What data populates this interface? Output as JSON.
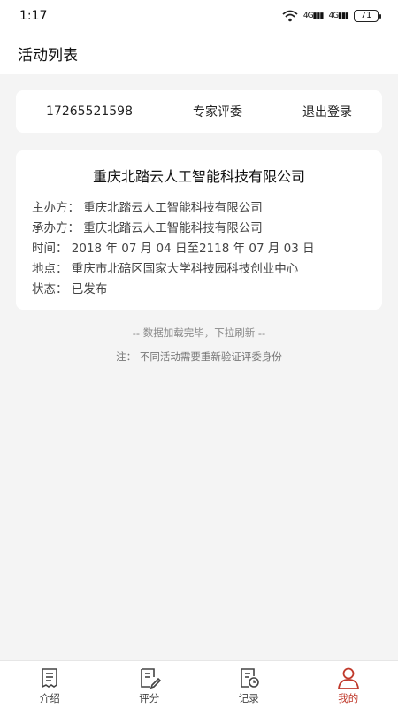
{
  "status_bar": {
    "time": "1:17",
    "signal1": "4G",
    "signal2": "4G",
    "battery": "71"
  },
  "header": {
    "title": "活动列表"
  },
  "user_card": {
    "phone": "17265521598",
    "role": "专家评委",
    "logout": "退出登录"
  },
  "event": {
    "title": "重庆北踏云人工智能科技有限公司",
    "organizer": "主办方：  重庆北踏云人工智能科技有限公司",
    "co_organizer": "承办方：  重庆北踏云人工智能科技有限公司",
    "time": "时间：  2018 年 07 月 04 日至2118 年 07 月 03 日",
    "location": "地点：  重庆市北碚区国家大学科技园科技创业中心",
    "status": "状态：  已发布"
  },
  "list_footer": "-- 数据加载完毕，下拉刷新 --",
  "note": "注：  不同活动需要重新验证评委身份",
  "tabs": [
    {
      "label": "介绍",
      "icon": "intro-icon"
    },
    {
      "label": "评分",
      "icon": "score-icon"
    },
    {
      "label": "记录",
      "icon": "record-icon"
    },
    {
      "label": "我的",
      "icon": "profile-icon"
    }
  ],
  "colors": {
    "accent": "#c0392b",
    "background": "#f4f4f4"
  }
}
